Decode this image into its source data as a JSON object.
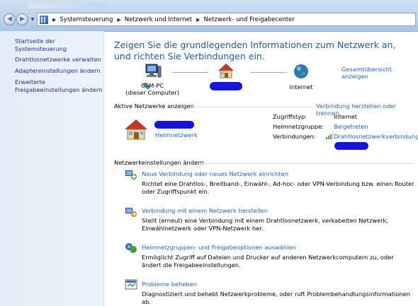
{
  "window": {
    "tab_title_hint": ""
  },
  "breadcrumb": {
    "items": [
      "Systemsteuerung",
      "Netzwerk und Internet",
      "Netzwerk- und Freigabecenter"
    ]
  },
  "sidebar": {
    "items": [
      {
        "label": "Startseite der Systemsteuerung"
      },
      {
        "label": "Drahtlosnetzwerke verwalten"
      },
      {
        "label": "Adaptereinstellungen ändern"
      },
      {
        "label": "Erweiterte\nFreigabeeinstellungen ändern"
      }
    ]
  },
  "main": {
    "headline": "Zeigen Sie die grundlegenden Informationen zum Netzwerk an, und richten Sie Verbindungen ein.",
    "overview_link": "Gesamtübersicht anzeigen",
    "network_map": {
      "computer_label": "CEM-PC\n(dieser Computer)",
      "internet_label": "Internet"
    },
    "active_networks": {
      "title": "Aktive Netzwerke anzeigen",
      "connect_link": "Verbindung herstellen oder trennen",
      "network_type": "Heimnetzwerk",
      "access_type_label": "Zugriffstyp:",
      "access_type_value": "Internet",
      "homegroup_label": "Heimnetzgruppe:",
      "homegroup_value": "Beigetreten",
      "connections_label": "Verbindungen:",
      "connections_value": "Drahtlosnetzwerkverbindung"
    },
    "settings": {
      "title": "Netzwerkeinstellungen ändern",
      "tasks": [
        {
          "link": "Neue Verbindung oder neues Netzwerk einrichten",
          "desc": "Richtet eine Drahtlos-, Breitband-, Einwähl-, Ad-hoc- oder VPN-Verbindung bzw. einen Router oder Zugriffspunkt ein."
        },
        {
          "link": "Verbindung mit einem Netzwerk herstellen",
          "desc": "Stellt (erneut) eine Verbindung mit einem Drahtlosnetzwerk, verkabelten Netzwerk, Einwählnetzwerk oder VPN-Netzwerk her."
        },
        {
          "link": "Heimnetzgruppen- und Freigabeoptionen auswählen",
          "desc": "Ermöglicht Zugriff auf Dateien und Drucker auf anderen Netzwerkcomputern zu, oder ändert die Freigabeeinstellungen."
        },
        {
          "link": "Probleme beheben",
          "desc": "Diagnostiziert und behebt Netzwerkprobleme, oder ruft Problembehandlungsinformationen ab."
        }
      ]
    }
  },
  "icons": {
    "back": "back-arrow-icon",
    "forward": "forward-arrow-icon",
    "control_panel": "control-panel-icon",
    "computer": "computer-icon",
    "house": "house-icon",
    "globe": "globe-icon",
    "signal": "signal-bars-icon",
    "new_connection": "network-setup-icon",
    "connect": "connect-network-icon",
    "homegroup": "homegroup-icon",
    "troubleshoot": "troubleshoot-icon"
  },
  "colors": {
    "link": "#1e64c8",
    "headline": "#1e5aa8",
    "redaction": "#1515d8",
    "nav_link": "#1e3287"
  }
}
